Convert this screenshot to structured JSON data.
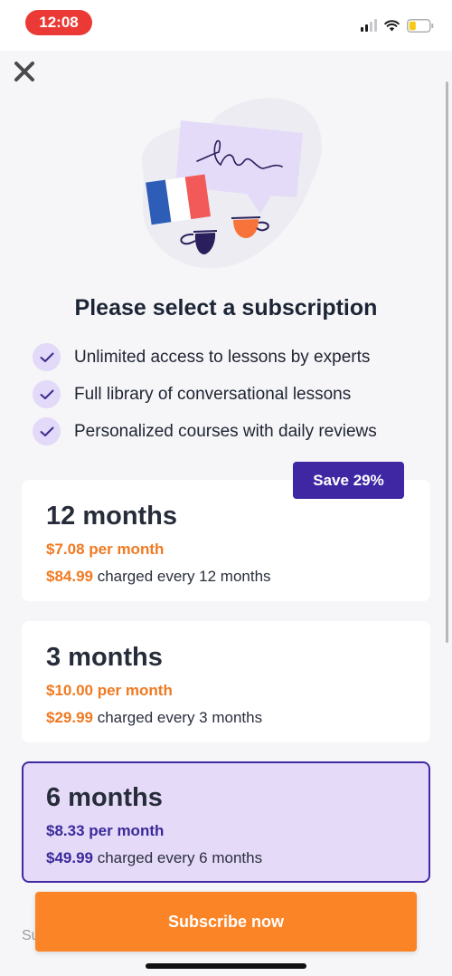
{
  "status_bar": {
    "time": "12:08",
    "icons": [
      "signal-icon",
      "wifi-icon",
      "battery-icon"
    ]
  },
  "close": {
    "icon": "close-icon"
  },
  "illustration": {
    "icon": "conversation-illustration",
    "colors": {
      "bubble": "#e4dbf8",
      "blob": "#ececf2",
      "flag_blue": "#2e5db8",
      "flag_red": "#f25a5a",
      "cup_dark": "#2a1f5c",
      "cup_orange": "#f7733a"
    }
  },
  "page": {
    "title": "Please select a subscription"
  },
  "features": [
    {
      "label": "Unlimited access to lessons by experts",
      "icon": "check-icon"
    },
    {
      "label": "Full library of conversational lessons",
      "icon": "check-icon"
    },
    {
      "label": "Personalized courses with daily reviews",
      "icon": "check-icon"
    }
  ],
  "plans": [
    {
      "title": "12 months",
      "per_month": "$7.08 per month",
      "amount": "$84.99",
      "charged_text": " charged every 12 months",
      "badge": "Save 29%",
      "selected": false
    },
    {
      "title": "3 months",
      "per_month": "$10.00 per month",
      "amount": "$29.99",
      "charged_text": " charged every 3 months",
      "selected": false
    },
    {
      "title": "6 months",
      "per_month": "$8.33 per month",
      "amount": "$49.99",
      "charged_text": " charged every 6 months",
      "selected": true
    }
  ],
  "cta": {
    "label": "Subscribe now"
  },
  "footer_peek": "Su",
  "colors": {
    "accent_orange": "#fb8427",
    "accent_purple": "#3f27a3",
    "selected_bg": "#e6daf9",
    "time_pill": "#eb3a36"
  }
}
